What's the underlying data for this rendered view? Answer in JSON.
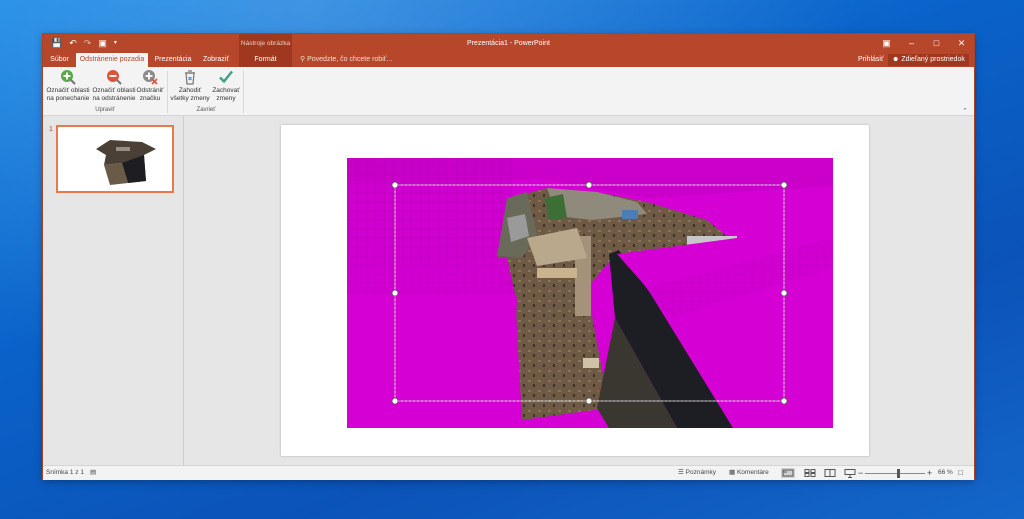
{
  "app": {
    "title": "Prezentácia1  -  PowerPoint",
    "tool_tab_header": "Nástroje obrázka"
  },
  "tabs": [
    {
      "label": "Súbor"
    },
    {
      "label": "Odstránenie pozadia"
    },
    {
      "label": "Prezentácia"
    },
    {
      "label": "Zobraziť"
    },
    {
      "label": "Formát"
    }
  ],
  "tell_me": "Povedzte, čo chcete robiť...",
  "signin": "Prihlásiť",
  "share": "Zdieľaný prostriedok",
  "ribbon": {
    "buttons": [
      {
        "line1": "Označiť oblasti",
        "line2": "na ponechanie",
        "icon": "plus-pencil-icon"
      },
      {
        "line1": "Označiť oblasti",
        "line2": "na odstránenie",
        "icon": "minus-pencil-icon"
      },
      {
        "line1": "Odstrániť",
        "line2": "značku",
        "icon": "delete-mark-icon"
      },
      {
        "line1": "Zahodiť",
        "line2": "všetky zmeny",
        "icon": "discard-icon"
      },
      {
        "line1": "Zachovať",
        "line2": "zmeny",
        "icon": "checkmark-icon"
      }
    ],
    "groups": [
      {
        "label": "Upraviť"
      },
      {
        "label": "Zavrieť"
      }
    ]
  },
  "thumbnail": {
    "number": "1"
  },
  "status": {
    "slide_info": "Snímka 1 z 1",
    "notes": "Poznámky",
    "comments": "Komentáre",
    "zoom_minus": "−",
    "zoom_plus": "+",
    "zoom": "66 %"
  },
  "zoom_level": 0.55,
  "colors": {
    "accent": "#b7472a",
    "background_removal": "#d400d4"
  }
}
